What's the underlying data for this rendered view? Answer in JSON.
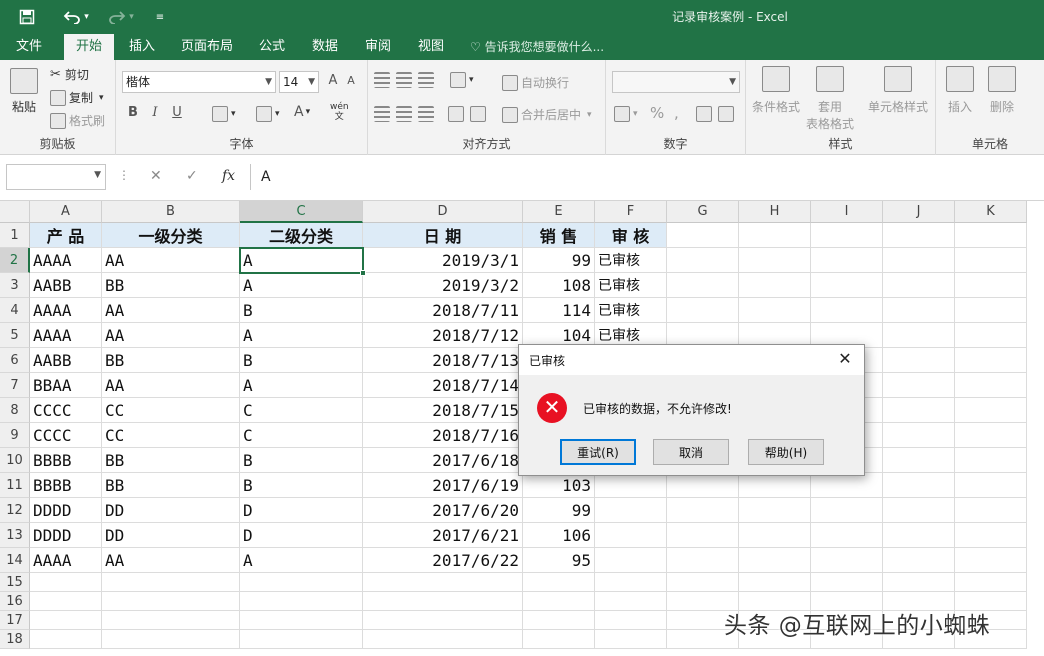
{
  "window": {
    "title": "记录审核案例 - Excel"
  },
  "quick_access": {
    "save_icon": "save-icon",
    "undo_icon": "undo-icon",
    "redo_icon": "redo-icon",
    "customize_icon": "customize-icon"
  },
  "tabs": [
    "文件",
    "开始",
    "插入",
    "页面布局",
    "公式",
    "数据",
    "审阅",
    "视图"
  ],
  "active_tab": "开始",
  "tell_me": "♡ 告诉我您想要做什么...",
  "ribbon": {
    "clipboard": {
      "paste": "粘贴",
      "cut": "剪切",
      "copy": "复制",
      "format_painter": "格式刷",
      "label": "剪贴板"
    },
    "font": {
      "name": "楷体",
      "size": "14",
      "label": "字体",
      "bold": "B",
      "italic": "I",
      "underline": "U",
      "grow": "A",
      "shrink": "A",
      "font_color": "A",
      "wen": "wén"
    },
    "alignment": {
      "wrap": "自动换行",
      "merge": "合并后居中",
      "label": "对齐方式"
    },
    "number": {
      "percent": "%",
      "comma": ",",
      "label": "数字"
    },
    "styles": {
      "conditional": "条件格式",
      "table_1": "套用",
      "table_2": "表格格式",
      "cell_styles": "单元格样式",
      "label": "样式"
    },
    "cells": {
      "insert": "插入",
      "delete": "删除",
      "label": "单元格"
    }
  },
  "formula_bar": {
    "name_box": "",
    "cancel": "✕",
    "enter": "✓",
    "fx": "fx",
    "value": "A"
  },
  "columns": [
    "A",
    "B",
    "C",
    "D",
    "E",
    "F",
    "G",
    "H",
    "I",
    "J",
    "K"
  ],
  "header_row": [
    "产 品",
    "一级分类",
    "二级分类",
    "日 期",
    "销 售",
    "审 核"
  ],
  "rows": [
    [
      "AAAA",
      "AA",
      "A",
      "2019/3/1",
      "99",
      "已审核"
    ],
    [
      "AABB",
      "BB",
      "A",
      "2019/3/2",
      "108",
      "已审核"
    ],
    [
      "AAAA",
      "AA",
      "B",
      "2018/7/11",
      "114",
      "已审核"
    ],
    [
      "AAAA",
      "AA",
      "A",
      "2018/7/12",
      "104",
      "已审核"
    ],
    [
      "AABB",
      "BB",
      "B",
      "2018/7/13",
      "",
      ""
    ],
    [
      "BBAA",
      "AA",
      "A",
      "2018/7/14",
      "",
      ""
    ],
    [
      "CCCC",
      "CC",
      "C",
      "2018/7/15",
      "",
      ""
    ],
    [
      "CCCC",
      "CC",
      "C",
      "2018/7/16",
      "",
      ""
    ],
    [
      "BBBB",
      "BB",
      "B",
      "2017/6/18",
      "",
      ""
    ],
    [
      "BBBB",
      "BB",
      "B",
      "2017/6/19",
      "103",
      ""
    ],
    [
      "DDDD",
      "DD",
      "D",
      "2017/6/20",
      "99",
      ""
    ],
    [
      "DDDD",
      "DD",
      "D",
      "2017/6/21",
      "106",
      ""
    ],
    [
      "AAAA",
      "AA",
      "A",
      "2017/6/22",
      "95",
      ""
    ]
  ],
  "row_numbers": [
    "1",
    "2",
    "3",
    "4",
    "5",
    "6",
    "7",
    "8",
    "9",
    "10",
    "11",
    "12",
    "13",
    "14",
    "15",
    "16",
    "17",
    "18"
  ],
  "dialog": {
    "title": "已审核",
    "close": "✕",
    "message": "已审核的数据，不允许修改!",
    "retry": "重试(R)",
    "cancel": "取消",
    "help": "帮助(H)"
  },
  "watermark": "头条 @互联网上的小蜘蛛",
  "colors": {
    "excel_green": "#217346",
    "header_fill": "#ddebf7",
    "error_red": "#e81123"
  }
}
